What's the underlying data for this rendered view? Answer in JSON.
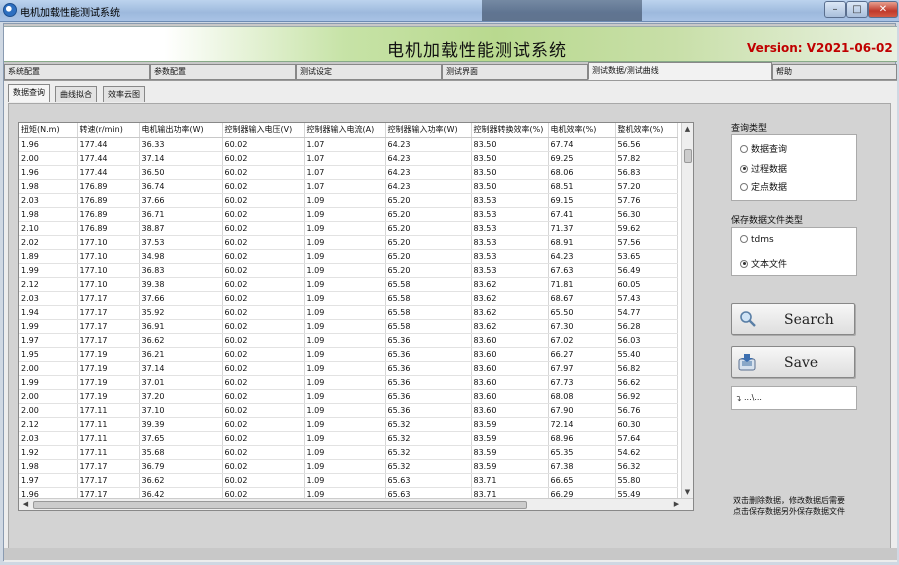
{
  "window": {
    "title": "电机加载性能测试系统"
  },
  "banner": {
    "title": "电机加载性能测试系统",
    "version": "Version: V2021-06-02"
  },
  "top_tabs": [
    "系统配置",
    "参数配置",
    "测试设定",
    "测试界面",
    "测试数据/测试曲线",
    "帮助"
  ],
  "sub_tabs": [
    "数据查询",
    "曲线拟合",
    "效率云图"
  ],
  "table": {
    "columns": [
      "扭矩(N.m)",
      "转速(r/min)",
      "电机输出功率(W)",
      "控制器输入电压(V)",
      "控制器输入电流(A)",
      "控制器输入功率(W)",
      "控制器转换效率(%)",
      "电机效率(%)",
      "整机效率(%)"
    ],
    "rows": [
      [
        "1.96",
        "177.44",
        "36.33",
        "60.02",
        "1.07",
        "64.23",
        "83.50",
        "67.74",
        "56.56"
      ],
      [
        "2.00",
        "177.44",
        "37.14",
        "60.02",
        "1.07",
        "64.23",
        "83.50",
        "69.25",
        "57.82"
      ],
      [
        "1.96",
        "177.44",
        "36.50",
        "60.02",
        "1.07",
        "64.23",
        "83.50",
        "68.06",
        "56.83"
      ],
      [
        "1.98",
        "176.89",
        "36.74",
        "60.02",
        "1.07",
        "64.23",
        "83.50",
        "68.51",
        "57.20"
      ],
      [
        "2.03",
        "176.89",
        "37.66",
        "60.02",
        "1.09",
        "65.20",
        "83.53",
        "69.15",
        "57.76"
      ],
      [
        "1.98",
        "176.89",
        "36.71",
        "60.02",
        "1.09",
        "65.20",
        "83.53",
        "67.41",
        "56.30"
      ],
      [
        "2.10",
        "176.89",
        "38.87",
        "60.02",
        "1.09",
        "65.20",
        "83.53",
        "71.37",
        "59.62"
      ],
      [
        "2.02",
        "177.10",
        "37.53",
        "60.02",
        "1.09",
        "65.20",
        "83.53",
        "68.91",
        "57.56"
      ],
      [
        "1.89",
        "177.10",
        "34.98",
        "60.02",
        "1.09",
        "65.20",
        "83.53",
        "64.23",
        "53.65"
      ],
      [
        "1.99",
        "177.10",
        "36.83",
        "60.02",
        "1.09",
        "65.20",
        "83.53",
        "67.63",
        "56.49"
      ],
      [
        "2.12",
        "177.10",
        "39.38",
        "60.02",
        "1.09",
        "65.58",
        "83.62",
        "71.81",
        "60.05"
      ],
      [
        "2.03",
        "177.17",
        "37.66",
        "60.02",
        "1.09",
        "65.58",
        "83.62",
        "68.67",
        "57.43"
      ],
      [
        "1.94",
        "177.17",
        "35.92",
        "60.02",
        "1.09",
        "65.58",
        "83.62",
        "65.50",
        "54.77"
      ],
      [
        "1.99",
        "177.17",
        "36.91",
        "60.02",
        "1.09",
        "65.58",
        "83.62",
        "67.30",
        "56.28"
      ],
      [
        "1.97",
        "177.17",
        "36.62",
        "60.02",
        "1.09",
        "65.36",
        "83.60",
        "67.02",
        "56.03"
      ],
      [
        "1.95",
        "177.19",
        "36.21",
        "60.02",
        "1.09",
        "65.36",
        "83.60",
        "66.27",
        "55.40"
      ],
      [
        "2.00",
        "177.19",
        "37.14",
        "60.02",
        "1.09",
        "65.36",
        "83.60",
        "67.97",
        "56.82"
      ],
      [
        "1.99",
        "177.19",
        "37.01",
        "60.02",
        "1.09",
        "65.36",
        "83.60",
        "67.73",
        "56.62"
      ],
      [
        "2.00",
        "177.19",
        "37.20",
        "60.02",
        "1.09",
        "65.36",
        "83.60",
        "68.08",
        "56.92"
      ],
      [
        "2.00",
        "177.11",
        "37.10",
        "60.02",
        "1.09",
        "65.36",
        "83.60",
        "67.90",
        "56.76"
      ],
      [
        "2.12",
        "177.11",
        "39.39",
        "60.02",
        "1.09",
        "65.32",
        "83.59",
        "72.14",
        "60.30"
      ],
      [
        "2.03",
        "177.11",
        "37.65",
        "60.02",
        "1.09",
        "65.32",
        "83.59",
        "68.96",
        "57.64"
      ],
      [
        "1.92",
        "177.11",
        "35.68",
        "60.02",
        "1.09",
        "65.32",
        "83.59",
        "65.35",
        "54.62"
      ],
      [
        "1.98",
        "177.17",
        "36.79",
        "60.02",
        "1.09",
        "65.32",
        "83.59",
        "67.38",
        "56.32"
      ],
      [
        "1.97",
        "177.17",
        "36.62",
        "60.02",
        "1.09",
        "65.63",
        "83.71",
        "66.65",
        "55.80"
      ],
      [
        "1.96",
        "177.17",
        "36.42",
        "60.02",
        "1.09",
        "65.63",
        "83.71",
        "66.29",
        "55.49"
      ]
    ]
  },
  "query_type": {
    "label": "查询类型",
    "options": [
      "数据查询",
      "过程数据",
      "定点数据"
    ],
    "selected": "过程数据"
  },
  "save_type": {
    "label": "保存数据文件类型",
    "options": [
      "tdms",
      "文本文件"
    ],
    "selected": "文本文件"
  },
  "buttons": {
    "search": "Search",
    "save": "Save"
  },
  "path": {
    "value": "...\\..."
  },
  "note": {
    "line1": "双击删除数据，修改数据后需要",
    "line2": "点击保存数据另外保存数据文件"
  },
  "colors": {
    "version": "#c00000",
    "banner_green": "#b9d98f"
  },
  "icons": {
    "search": "magnifier-icon",
    "save": "disk-save-icon",
    "path": "folder-path-icon"
  }
}
